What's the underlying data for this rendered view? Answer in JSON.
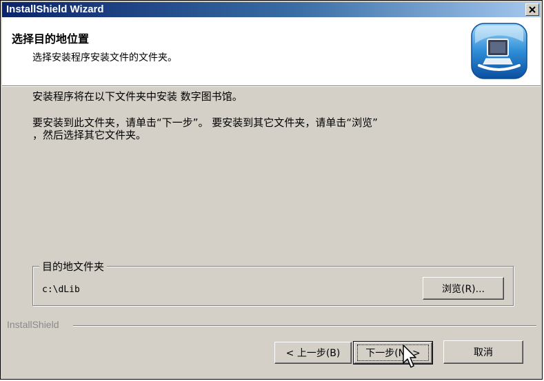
{
  "window": {
    "title": "InstallShield Wizard",
    "close_icon": "close-icon"
  },
  "header": {
    "title": "选择目的地位置",
    "subtitle": "选择安装程序安装文件的文件夹。",
    "logo_icon": "computer-install-icon"
  },
  "body": {
    "line1": "安装程序将在以下文件夹中安装 数字图书馆。",
    "line2a": "要安装到此文件夹，请单击“下一步”。 要安装到其它文件夹，请单击“浏览”",
    "line2b": "，然后选择其它文件夹。"
  },
  "destination": {
    "legend": "目的地文件夹",
    "path": "c:\\dLib",
    "browse_label": "浏览(R)..."
  },
  "footer": {
    "brand": "InstallShield",
    "back_label": "< 上一步(B)",
    "next_label": "下一步(N) >",
    "cancel_label": "取消"
  },
  "colors": {
    "face": "#d4d0c8",
    "title_start": "#0a246a",
    "title_end": "#a6caf0"
  }
}
